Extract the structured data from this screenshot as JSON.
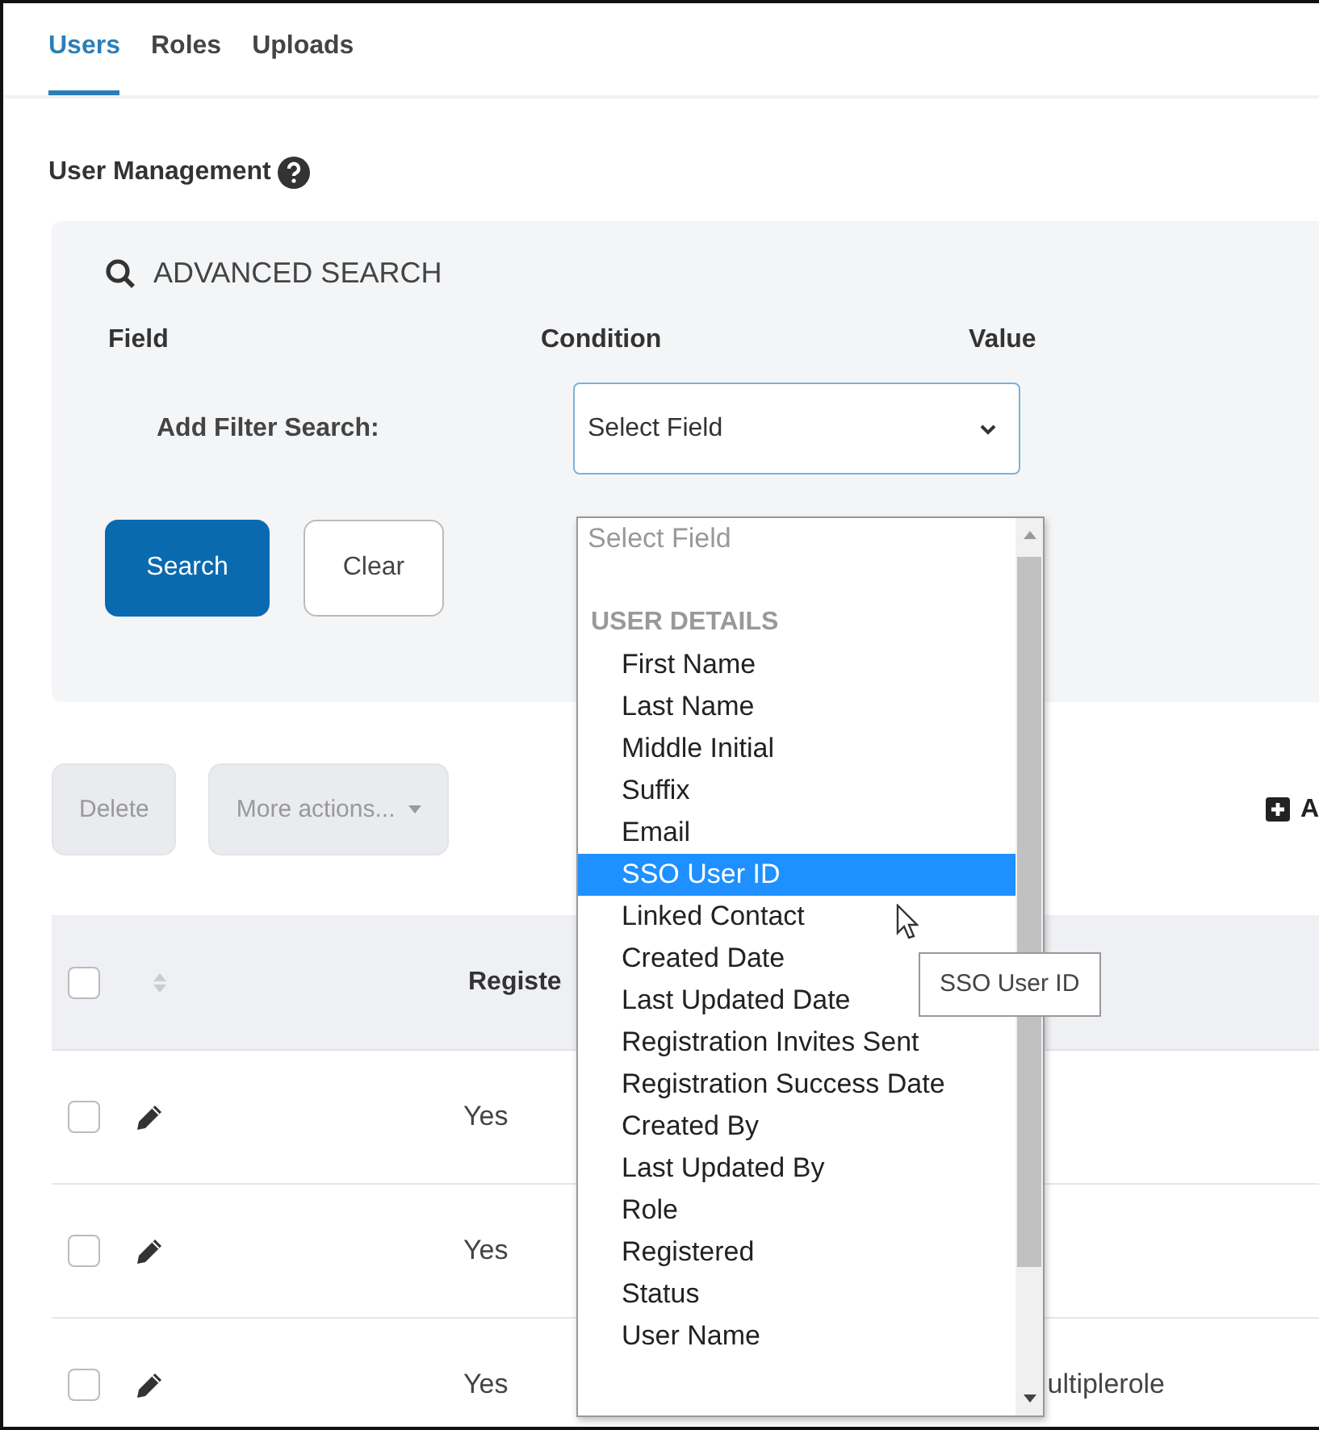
{
  "tabs": [
    {
      "label": "Users",
      "selected": true
    },
    {
      "label": "Roles",
      "selected": false
    },
    {
      "label": "Uploads",
      "selected": false
    }
  ],
  "page_title": "User Management",
  "advanced_search": {
    "title": "ADVANCED SEARCH",
    "columns": [
      "Field",
      "Condition",
      "Value"
    ],
    "filter_label": "Add Filter Search:",
    "select": {
      "value": "Select Field",
      "expanded": true
    },
    "buttons": [
      {
        "label": "Search",
        "kind": "primary"
      },
      {
        "label": "Clear",
        "kind": "secondary"
      }
    ]
  },
  "dropdown": {
    "placeholder_option": "Select Field",
    "groups": [
      {
        "label": "USER DETAILS",
        "options": [
          {
            "label": "First Name",
            "selected": false
          },
          {
            "label": "Last Name",
            "selected": false
          },
          {
            "label": "Middle Initial",
            "selected": false
          },
          {
            "label": "Suffix",
            "selected": false
          },
          {
            "label": "Email",
            "selected": false
          },
          {
            "label": "SSO User ID",
            "selected": true
          },
          {
            "label": "Linked Contact",
            "selected": false
          },
          {
            "label": "Created Date",
            "selected": false
          },
          {
            "label": "Last Updated Date",
            "selected": false
          },
          {
            "label": "Registration Invites Sent",
            "selected": false
          },
          {
            "label": "Registration Success Date",
            "selected": false
          },
          {
            "label": "Created By",
            "selected": false
          },
          {
            "label": "Last Updated By",
            "selected": false
          },
          {
            "label": "Role",
            "selected": false
          },
          {
            "label": "Registered",
            "selected": false
          },
          {
            "label": "Status",
            "selected": false
          },
          {
            "label": "User Name",
            "selected": false
          }
        ]
      }
    ],
    "tooltip": "SSO User ID"
  },
  "toolbar": {
    "buttons": [
      {
        "label": "Delete",
        "disabled": true,
        "kind": "plain"
      },
      {
        "label": "More actions...",
        "disabled": true,
        "kind": "menu"
      }
    ],
    "add_label": "A"
  },
  "table": {
    "header": {
      "checked": false,
      "column_3": "Registe"
    },
    "rows": [
      {
        "checked": false,
        "registered": "Yes"
      },
      {
        "checked": false,
        "registered": "Yes"
      },
      {
        "checked": false,
        "registered": "Yes",
        "column_4": "ultiplerole"
      }
    ]
  }
}
